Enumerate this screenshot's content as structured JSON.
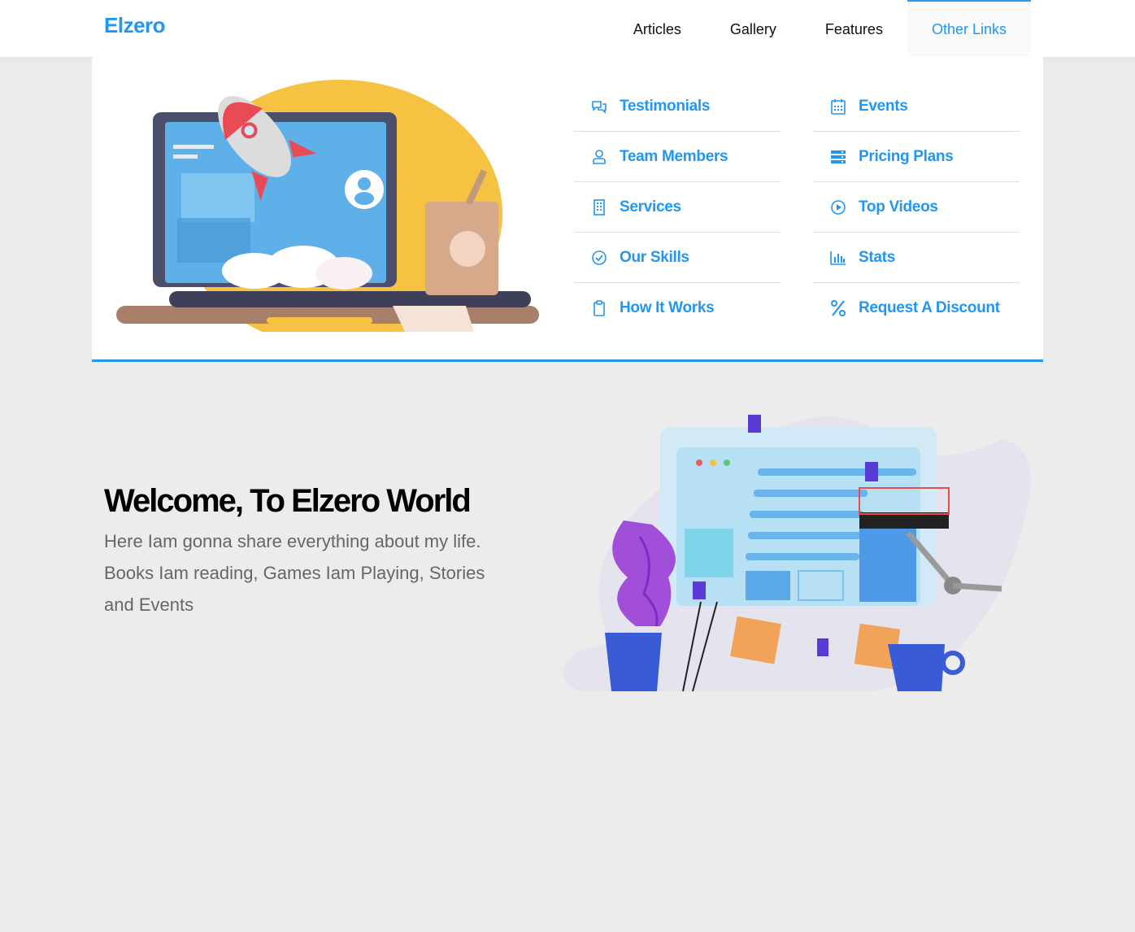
{
  "header": {
    "logo": "Elzero",
    "nav": [
      {
        "label": "Articles",
        "active": false
      },
      {
        "label": "Gallery",
        "active": false
      },
      {
        "label": "Features",
        "active": false
      },
      {
        "label": "Other Links",
        "active": true
      }
    ]
  },
  "mega_menu": {
    "column1": [
      {
        "label": "Testimonials",
        "icon": "comments-icon"
      },
      {
        "label": "Team Members",
        "icon": "user-icon"
      },
      {
        "label": "Services",
        "icon": "building-icon"
      },
      {
        "label": "Our Skills",
        "icon": "check-circle-icon"
      },
      {
        "label": "How It Works",
        "icon": "clipboard-icon"
      }
    ],
    "column2": [
      {
        "label": "Events",
        "icon": "calendar-icon"
      },
      {
        "label": "Pricing Plans",
        "icon": "server-icon"
      },
      {
        "label": "Top Videos",
        "icon": "play-circle-icon"
      },
      {
        "label": "Stats",
        "icon": "chart-bar-icon"
      },
      {
        "label": "Request A Discount",
        "icon": "percent-icon"
      }
    ]
  },
  "landing": {
    "title": "Welcome, To Elzero World",
    "text": "Here Iam gonna share everything about my life. Books Iam reading, Games Iam Playing, Stories and Events"
  },
  "colors": {
    "accent": "#2196f3",
    "background": "#ececec"
  }
}
